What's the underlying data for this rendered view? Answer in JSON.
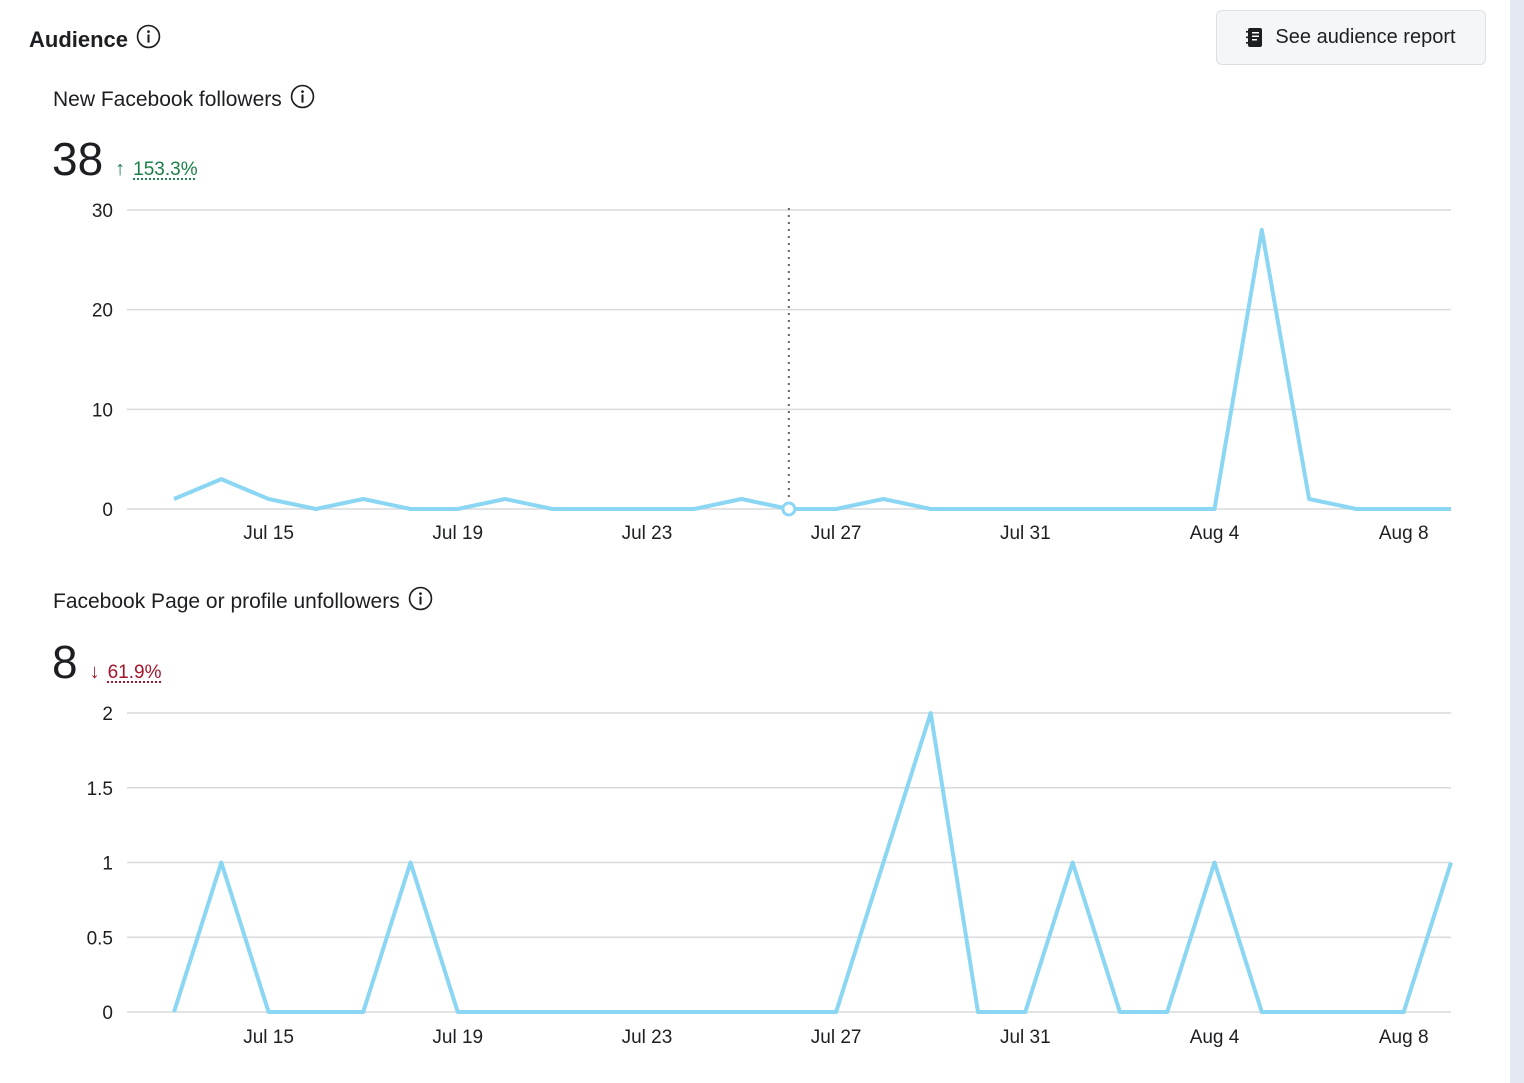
{
  "header": {
    "title": "Audience",
    "report_button_label": "See audience report"
  },
  "colors": {
    "line": "#8ad6f3",
    "up": "#1a7f47",
    "down": "#a3162b"
  },
  "metrics": [
    {
      "label": "New Facebook followers",
      "value": "38",
      "change_direction": "up",
      "change_pct": "153.3%"
    },
    {
      "label": "Facebook Page or profile unfollowers",
      "value": "8",
      "change_direction": "down",
      "change_pct": "61.9%"
    }
  ],
  "chart_data": [
    {
      "type": "line",
      "x": [
        "Jul 13",
        "Jul 14",
        "Jul 15",
        "Jul 16",
        "Jul 17",
        "Jul 18",
        "Jul 19",
        "Jul 20",
        "Jul 21",
        "Jul 22",
        "Jul 23",
        "Jul 24",
        "Jul 25",
        "Jul 26",
        "Jul 27",
        "Jul 28",
        "Jul 29",
        "Jul 30",
        "Jul 31",
        "Aug 1",
        "Aug 2",
        "Aug 3",
        "Aug 4",
        "Aug 5",
        "Aug 6",
        "Aug 7",
        "Aug 8",
        "Aug 9"
      ],
      "series": [
        {
          "values": [
            1,
            3,
            1,
            0,
            1,
            0,
            0,
            1,
            0,
            0,
            0,
            0,
            1,
            0,
            0,
            1,
            0,
            0,
            0,
            0,
            0,
            0,
            0,
            28,
            1,
            0,
            0,
            0
          ]
        }
      ],
      "x_tick_labels": [
        "Jul 15",
        "Jul 19",
        "Jul 23",
        "Jul 27",
        "Jul 31",
        "Aug 4",
        "Aug 8"
      ],
      "y_ticks": [
        "0",
        "10",
        "20",
        "30"
      ],
      "ylim": [
        0,
        30
      ],
      "grid": true,
      "highlighted_x": "Jul 26"
    },
    {
      "type": "line",
      "x": [
        "Jul 13",
        "Jul 14",
        "Jul 15",
        "Jul 16",
        "Jul 17",
        "Jul 18",
        "Jul 19",
        "Jul 20",
        "Jul 21",
        "Jul 22",
        "Jul 23",
        "Jul 24",
        "Jul 25",
        "Jul 26",
        "Jul 27",
        "Jul 28",
        "Jul 29",
        "Jul 30",
        "Jul 31",
        "Aug 1",
        "Aug 2",
        "Aug 3",
        "Aug 4",
        "Aug 5",
        "Aug 6",
        "Aug 7",
        "Aug 8",
        "Aug 9"
      ],
      "series": [
        {
          "values": [
            0,
            1,
            0,
            0,
            0,
            1,
            0,
            0,
            0,
            0,
            0,
            0,
            0,
            0,
            0,
            1,
            2,
            0,
            0,
            1,
            0,
            0,
            1,
            0,
            0,
            0,
            0,
            1
          ]
        }
      ],
      "x_tick_labels": [
        "Jul 15",
        "Jul 19",
        "Jul 23",
        "Jul 27",
        "Jul 31",
        "Aug 4",
        "Aug 8"
      ],
      "y_ticks": [
        "0",
        "0.5",
        "1",
        "1.5",
        "2"
      ],
      "ylim": [
        0,
        2
      ],
      "grid": true
    }
  ]
}
